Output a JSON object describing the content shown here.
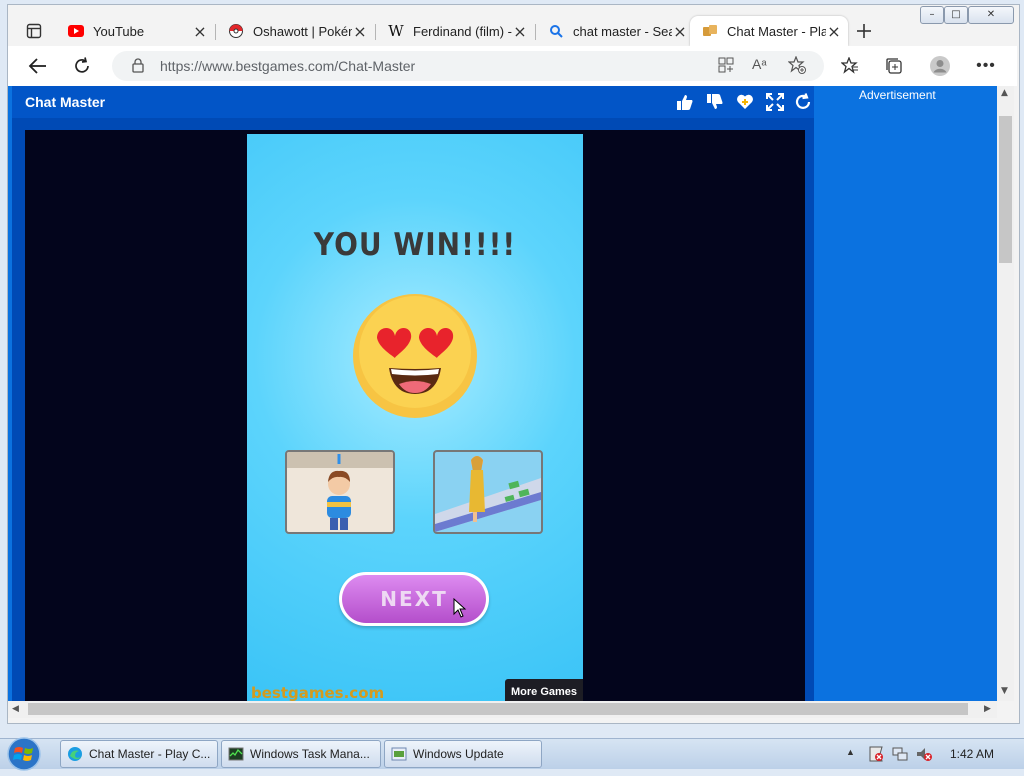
{
  "browser": {
    "tabs": [
      {
        "title": "YouTube",
        "icon": "youtube-icon"
      },
      {
        "title": "Oshawott | Pokémon",
        "icon": "pokeball-icon"
      },
      {
        "title": "Ferdinand (film) - Wikipedia",
        "icon": "wikipedia-icon"
      },
      {
        "title": "chat master - Search",
        "icon": "search-icon"
      },
      {
        "title": "Chat Master - Play Online",
        "icon": "bestgames-icon",
        "active": true
      }
    ],
    "url_prefix": "https://www.bestgames.com",
    "url_path": "/Chat-Master"
  },
  "page": {
    "game_title": "Chat Master",
    "advertisement": "Advertisement",
    "game": {
      "win_text": "YOU WIN!!!!",
      "next_label": "NEXT",
      "brand": "bestgames.com",
      "more_games": "More Games"
    }
  },
  "taskbar": {
    "items": [
      {
        "label": "Chat Master - Play C...",
        "icon": "edge-icon"
      },
      {
        "label": "Windows Task Mana...",
        "icon": "task-manager-icon"
      },
      {
        "label": "Windows Update",
        "icon": "windows-update-icon"
      }
    ],
    "clock": "1:42 AM"
  },
  "colors": {
    "site_blue": "#0b72e0",
    "header_blue": "#0255c7",
    "game_bg": "#37c2f6",
    "next_button": "#c065d8"
  }
}
